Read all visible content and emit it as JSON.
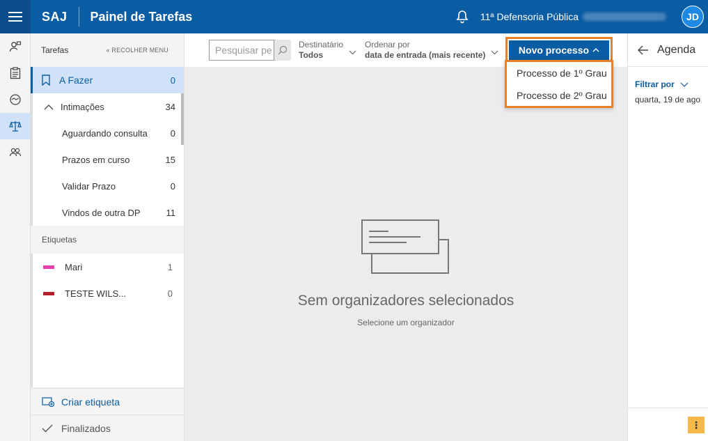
{
  "header": {
    "brand": "SAJ",
    "title": "Painel de Tarefas",
    "unit": "11ª Defensoria Pública",
    "avatar": "JD"
  },
  "sidebar": {
    "heading": "Tarefas",
    "collapse_label": "RECOLHER MENU",
    "todo": {
      "label": "A Fazer",
      "count": "0"
    },
    "items": [
      {
        "label": "Intimações",
        "count": "34"
      },
      {
        "label": "Aguardando consulta",
        "count": "0"
      },
      {
        "label": "Prazos em curso",
        "count": "15"
      },
      {
        "label": "Validar Prazo",
        "count": "0"
      },
      {
        "label": "Vindos de outra DP",
        "count": "11"
      }
    ],
    "labels_heading": "Etiquetas",
    "tags": [
      {
        "label": "Mari",
        "count": "1",
        "color": "#e83fb1"
      },
      {
        "label": "TESTE WILS...",
        "count": "0",
        "color": "#b3202b"
      }
    ],
    "create_tag": "Criar etiqueta",
    "finished": "Finalizados"
  },
  "toolbar": {
    "search_placeholder": "Pesquisar pe",
    "recipient_label": "Destinatário",
    "recipient_value": "Todos",
    "order_label": "Ordenar por",
    "order_value": "data de entrada (mais recente)",
    "new_process": "Novo processo"
  },
  "menu": {
    "items": [
      "Processo de 1º Grau",
      "Processo de 2º Grau"
    ]
  },
  "main": {
    "empty_title": "Sem organizadores selecionados",
    "empty_subtitle": "Selecione um organizador"
  },
  "agenda": {
    "title": "Agenda",
    "filter": "Filtrar por",
    "date": "quarta, 19 de ago"
  },
  "colors": {
    "brand": "#0a5ca3",
    "highlight": "#e8822a",
    "active_bg": "#cfe2f7"
  }
}
